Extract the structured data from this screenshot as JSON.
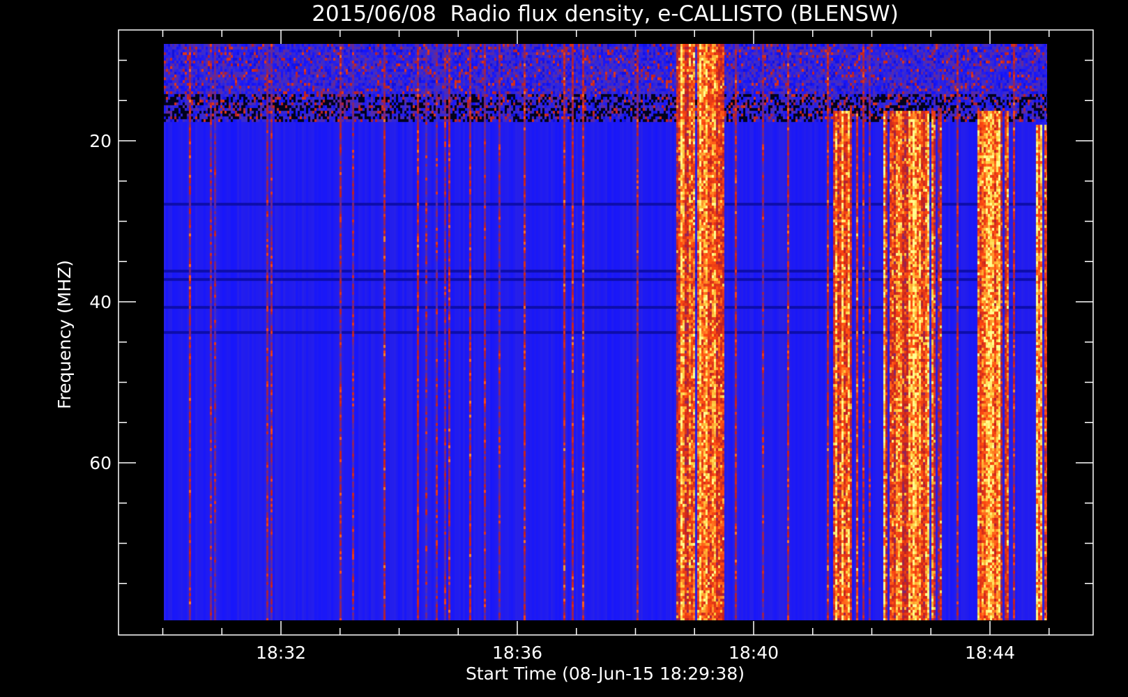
{
  "chart_data": {
    "type": "heatmap",
    "title": "2015/06/08  Radio flux density, e-CALLISTO (BLENSW)",
    "xlabel": "Start Time (08-Jun-15 18:29:38)",
    "ylabel": "Frequency (MHZ)",
    "x_range": [
      "18:29:38",
      "18:45:00"
    ],
    "y_range_mhz": [
      6,
      80
    ],
    "y_axis_inverted": true,
    "x_major_ticks": [
      "18:32",
      "18:36",
      "18:40",
      "18:44"
    ],
    "y_major_ticks": [
      20,
      40,
      60
    ],
    "colormap": [
      "#000000",
      "#1414ff",
      "#3a2cd0",
      "#c02020",
      "#ff4a10",
      "#ffd040",
      "#ffff90"
    ],
    "background_color": "#000000",
    "axis_color": "#ffffff",
    "bursts": [
      {
        "start": "18:38:40",
        "end": "18:39:30",
        "freq_mhz": [
          6,
          80
        ]
      },
      {
        "start": "18:41:20",
        "end": "18:41:50",
        "freq_mhz": [
          16,
          80
        ]
      },
      {
        "start": "18:42:10",
        "end": "18:43:10",
        "freq_mhz": [
          16,
          80
        ]
      },
      {
        "start": "18:43:40",
        "end": "18:44:20",
        "freq_mhz": [
          16,
          80
        ]
      },
      {
        "start": "18:44:45",
        "end": "18:45:00",
        "freq_mhz": [
          18,
          80
        ]
      }
    ]
  }
}
